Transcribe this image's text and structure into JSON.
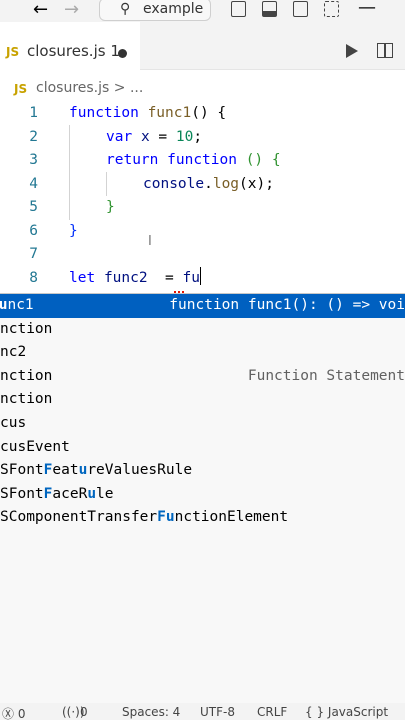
{
  "titlebar": {
    "back_icon": "arrow-left-icon",
    "forward_icon": "arrow-right-icon",
    "search_text": "example"
  },
  "tab": {
    "badge": "JS",
    "filename": "closures.js 1"
  },
  "breadcrumb": {
    "badge": "JS",
    "path": "closures.js > ..."
  },
  "editor": {
    "lines": [
      {
        "num": "1"
      },
      {
        "num": "2"
      },
      {
        "num": "3"
      },
      {
        "num": "4"
      },
      {
        "num": "5"
      },
      {
        "num": "6"
      },
      {
        "num": "7"
      },
      {
        "num": "8"
      }
    ],
    "tokens": {
      "l1_kw": "function",
      "l1_fn": "func1",
      "l1_rest": "() {",
      "l2_kw": "var",
      "l2_var": "x",
      "l2_eq": " = ",
      "l2_num": "10",
      "l2_end": ";",
      "l3_kw1": "return",
      "l3_kw2": "function",
      "l3_rest": " () {",
      "l4_obj": "console",
      "l4_dot": ".",
      "l4_fn": "log",
      "l4_rest": "(x);",
      "l5_brace": "}",
      "l6_brace": "}",
      "l8_kw": "let",
      "l8_var": "func2",
      "l8_eq": "  = ",
      "l8_typed": "fu"
    }
  },
  "suggestions": [
    {
      "pre": "",
      "hl": "fu",
      "post": "nc1",
      "detail": "function func1(): () => voi",
      "clip_left": true
    },
    {
      "pre": "",
      "hl": "",
      "post": "nction",
      "detail": ""
    },
    {
      "pre": "",
      "hl": "",
      "post": "nc2",
      "detail": ""
    },
    {
      "pre": "",
      "hl": "",
      "post": "nction",
      "detail": "Function Statement"
    },
    {
      "pre": "",
      "hl": "",
      "post": "nction",
      "detail": ""
    },
    {
      "pre": "",
      "hl": "",
      "post": "cus",
      "detail": ""
    },
    {
      "pre": "",
      "hl": "",
      "post": "cusEvent",
      "detail": ""
    },
    {
      "pre": "SFont",
      "hl": "F",
      "post": "eat",
      "hl2": "u",
      "post2": "reValuesRule",
      "detail": ""
    },
    {
      "pre": "SFont",
      "hl": "F",
      "post": "aceR",
      "hl2": "u",
      "post2": "le",
      "detail": ""
    },
    {
      "pre": "SComponentTransfer",
      "hl": "Fu",
      "post": "nctionElement",
      "detail": ""
    }
  ],
  "status": {
    "errors": "Ⓧ 0",
    "ports": "0",
    "spaces": "Spaces: 4",
    "encoding": "UTF-8",
    "eol": "CRLF",
    "language": "{ } JavaScript"
  }
}
